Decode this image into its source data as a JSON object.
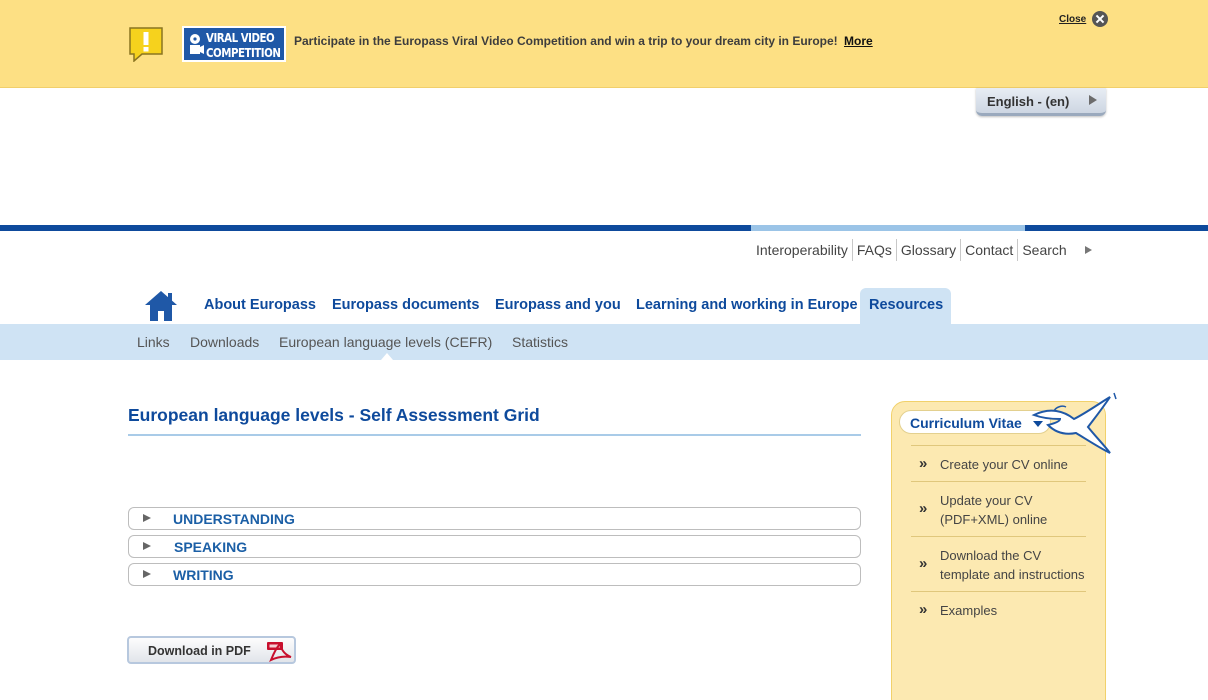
{
  "banner": {
    "logo_line1": "VIRAL VIDEO",
    "logo_line2": "COMPETITION",
    "message": "Participate in the Europass Viral Video Competition and win a trip to your dream city in Europe!",
    "more_link": "More",
    "close_label": "Close"
  },
  "language": {
    "label": "English - (en)"
  },
  "utility_nav": [
    "Interoperability",
    "FAQs",
    "Glossary",
    "Contact",
    "Search"
  ],
  "main_nav": {
    "items": [
      "About Europass",
      "Europass documents",
      "Europass and you",
      "Learning and working in Europe",
      "Resources"
    ],
    "active": "Resources"
  },
  "sub_nav": {
    "items": [
      "Links",
      "Downloads",
      "European language levels (CEFR)",
      "Statistics"
    ],
    "active": "European language levels (CEFR)"
  },
  "content": {
    "title": "European language levels - Self Assessment Grid",
    "accordion": [
      "UNDERSTANDING",
      "SPEAKING",
      "WRITING"
    ],
    "download_button": "Download in PDF"
  },
  "sidebar": {
    "title": "Curriculum Vitae",
    "items": [
      "Create your CV online",
      "Update your CV (PDF+XML) online",
      "Download the CV template and instructions",
      "Examples"
    ],
    "bullet": "»"
  },
  "colors": {
    "banner_bg": "#fde084",
    "brand_blue": "#0e4a9c",
    "light_blue": "#cfe3f4",
    "sidebar_bg": "#fce9b1"
  }
}
